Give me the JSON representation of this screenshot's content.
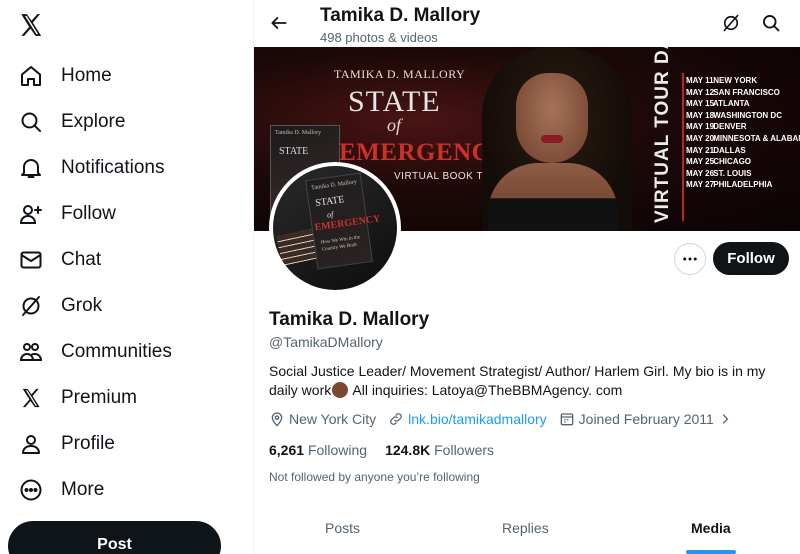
{
  "sidebar": {
    "items": [
      {
        "label": "Home",
        "icon": "home-icon"
      },
      {
        "label": "Explore",
        "icon": "search-icon"
      },
      {
        "label": "Notifications",
        "icon": "bell-icon"
      },
      {
        "label": "Follow",
        "icon": "add-person-icon"
      },
      {
        "label": "Chat",
        "icon": "envelope-icon"
      },
      {
        "label": "Grok",
        "icon": "grok-icon"
      },
      {
        "label": "Communities",
        "icon": "communities-icon"
      },
      {
        "label": "Premium",
        "icon": "x-logo-icon"
      },
      {
        "label": "Profile",
        "icon": "person-icon"
      },
      {
        "label": "More",
        "icon": "more-circle-icon"
      }
    ],
    "post_label": "Post"
  },
  "header": {
    "title": "Tamika D. Mallory",
    "subtitle": "498 photos & videos"
  },
  "banner": {
    "author": "TAMIKA D. MALLORY",
    "title_line1": "STATE",
    "title_line2": "of",
    "title_line3": "EMERGENCY",
    "tagline": "VIRTUAL BOOK TOUR",
    "book_small_author": "Tamika D. Mallory",
    "book_small_title": "STATE",
    "tour_heading": "VIRTUAL TOUR DATES",
    "tour_dates": [
      {
        "date": "MAY 11",
        "city": "NEW YORK"
      },
      {
        "date": "MAY 12",
        "city": "SAN FRANCISCO"
      },
      {
        "date": "MAY 15",
        "city": "ATLANTA"
      },
      {
        "date": "MAY 18",
        "city": "WASHINGTON DC"
      },
      {
        "date": "MAY 19",
        "city": "DENVER"
      },
      {
        "date": "MAY 20",
        "city": "MINNESOTA & ALABAMA"
      },
      {
        "date": "MAY 21",
        "city": "DALLAS"
      },
      {
        "date": "MAY 25",
        "city": "CHICAGO"
      },
      {
        "date": "MAY 26",
        "city": "ST. LOUIS"
      },
      {
        "date": "MAY 27",
        "city": "PHILADELPHIA"
      }
    ]
  },
  "avatar": {
    "book_author": "Tamika D. Mallory",
    "book_title": "STATE",
    "book_of": "of",
    "book_emergency": "EMERGENCY",
    "book_subtitle": "How We Win in the Country We Built"
  },
  "profile": {
    "follow_label": "Follow",
    "name": "Tamika D. Mallory",
    "handle": "@TamikaDMallory",
    "bio_part1": "Social Justice Leader/ Movement Strategist/ Author/ Harlem Girl. My bio is in my daily work",
    "bio_part2": " All inquiries: Latoya@TheBBMAgency. com",
    "location": "New York City",
    "link": "lnk.bio/tamikadmallory",
    "joined": "Joined February 2011",
    "following_count": "6,261",
    "following_label": "Following",
    "followers_count": "124.8K",
    "followers_label": "Followers",
    "not_followed": "Not followed by anyone you’re following"
  },
  "tabs": [
    {
      "label": "Posts"
    },
    {
      "label": "Replies"
    },
    {
      "label": "Media"
    }
  ],
  "active_tab": "Media",
  "colors": {
    "accent": "#1d9bf0",
    "text": "#0f1419",
    "muted": "#536471",
    "emergency_red": "#c83228"
  }
}
